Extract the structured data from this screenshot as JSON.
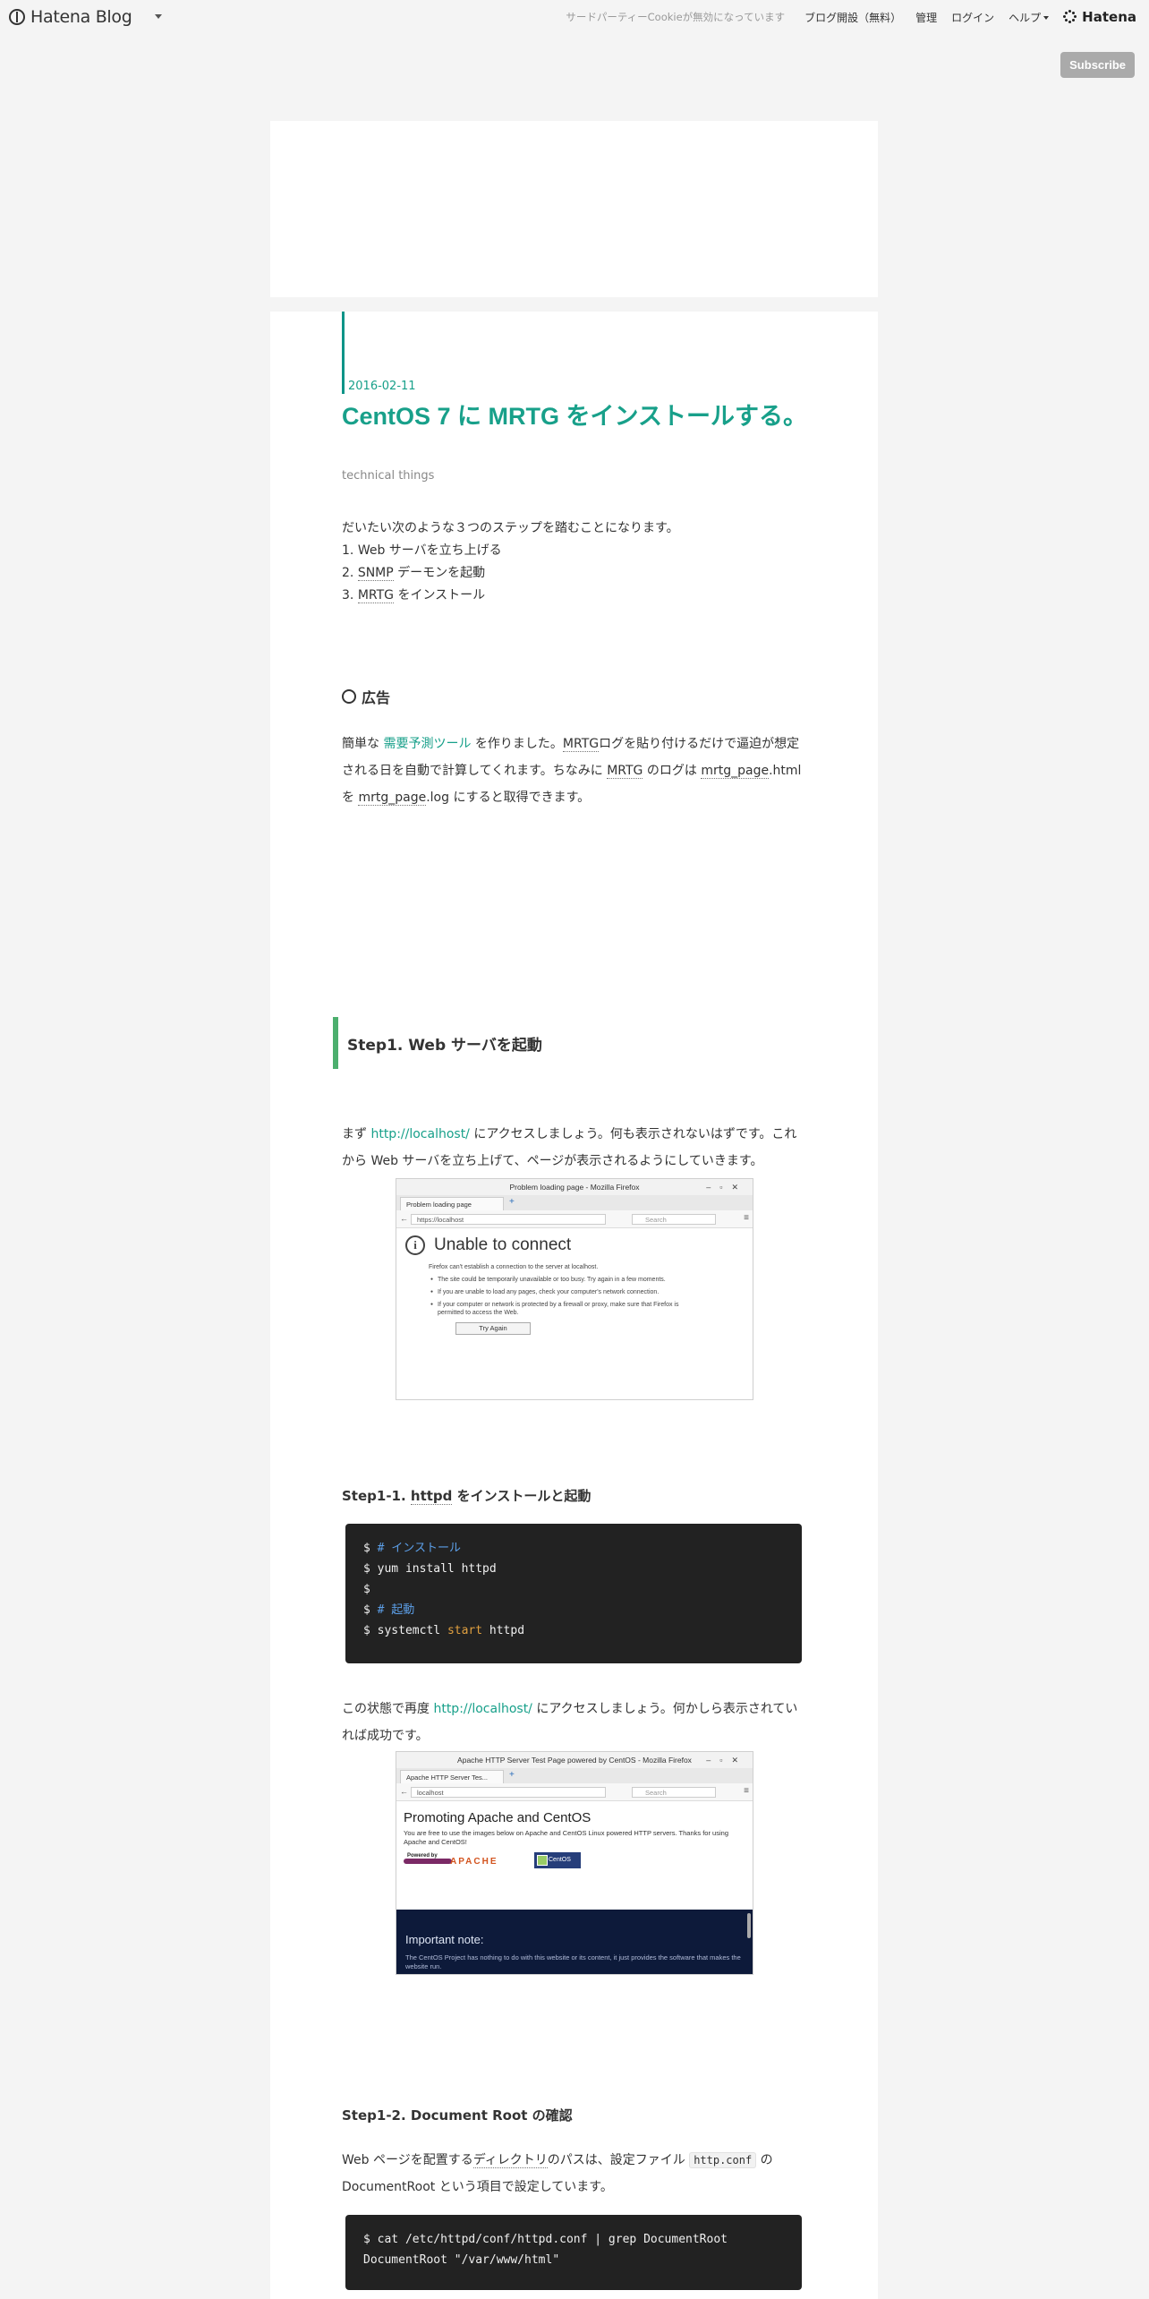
{
  "topbar": {
    "logo_text": "Hatena Blog",
    "cookie_notice": "サードパーティーCookieが無効になっています",
    "nav_items": [
      "ブログ開設（無料）",
      "管理",
      "ログイン"
    ],
    "help_label": "ヘルプ",
    "brand": "Hatena",
    "subscribe_label": "Subscribe"
  },
  "article": {
    "date": "2016-02-11",
    "title": "CentOS 7 に MRTG をインストールする。",
    "category": "technical things",
    "intro": "だいたい次のような３つのステップを踏むことになります。",
    "steps": [
      {
        "pre": "1. ",
        "text": "Web サーバを立ち上げる"
      },
      {
        "pre": "2. ",
        "term": "SNMP",
        "text": " デーモンを起動"
      },
      {
        "pre": "3. ",
        "term": "MRTG",
        "text": " をインストール"
      }
    ],
    "ad_heading": "広告",
    "ad_para": {
      "p1": "簡単な ",
      "link": "需要予測ツール",
      "p2": " を作りました。",
      "t1": "MRTG",
      "p3": "ログを貼り付けるだけで逼迫が想定される日を自動で計算してくれます。ちなみに ",
      "t2": "MRTG",
      "p4": " のログは ",
      "t3": "mrtg_page",
      "p5": ".html を ",
      "t4": "mrtg_page",
      "p6": ".log にすると取得できます。"
    },
    "step1_heading": "Step1. Web サーバを起動",
    "step1_para": {
      "p1": "まず ",
      "link": "http://localhost/",
      "p2": " にアクセスしましょう。何も表示されないはずです。これから Web サーバを立ち上げて、ページが表示されるようにしていきます。"
    },
    "shot1": {
      "window_title": "Problem loading page - Mozilla Firefox",
      "tab": "Problem loading page",
      "url": "https://localhost",
      "search": "Search",
      "heading": "Unable to connect",
      "sub": "Firefox can't establish a connection to the server at localhost.",
      "bullets": [
        "The site could be temporarily unavailable or too busy. Try again in a few moments.",
        "If you are unable to load any pages, check your computer's network connection.",
        "If your computer or network is protected by a firewall or proxy, make sure that Firefox is permitted to access the Web."
      ],
      "button": "Try Again"
    },
    "step1_1": {
      "pre": "Step1-1. ",
      "term": "httpd",
      "post": " をインストールと起動"
    },
    "code1": [
      {
        "prompt": "$ ",
        "comment": "# インストール"
      },
      {
        "prompt": "$ ",
        "text": "yum install httpd"
      },
      {
        "prompt": "$"
      },
      {
        "prompt": "$ ",
        "comment": "# 起動"
      },
      {
        "prompt": "$ ",
        "text": "systemctl ",
        "keyword": "start",
        "text2": " httpd"
      }
    ],
    "step1_1_para": {
      "p1": "この状態で再度 ",
      "link": "http://localhost/",
      "p2": " にアクセスしましょう。何かしら表示されていれば成功です。"
    },
    "shot2": {
      "window_title": "Apache HTTP Server Test Page powered by CentOS - Mozilla Firefox",
      "tab": "Apache HTTP Server Tes...",
      "url": "localhost",
      "search": "Search",
      "heading": "Promoting Apache and CentOS",
      "text": "You are free to use the images below on Apache and CentOS Linux powered HTTP servers. Thanks for using Apache and CentOS!",
      "powered": "Powered by",
      "apache": "APACHE",
      "centos": "CentOS",
      "note_title": "Important note:",
      "note_text": "The CentOS Project has nothing to do with this website or its content, it just provides the software that makes the website run."
    },
    "step1_2": "Step1-2. Document Root の確認",
    "step1_2_para": {
      "p1": "Web ページを配置する",
      "term": "ディレクトリ",
      "p2": "のパスは、設定ファイル ",
      "code": "http.conf",
      "p3": " の DocumentRoot という項目で設定しています。"
    },
    "code2": [
      "$ cat /etc/httpd/conf/httpd.conf | grep DocumentRoot",
      "DocumentRoot \"/var/www/html\""
    ]
  }
}
